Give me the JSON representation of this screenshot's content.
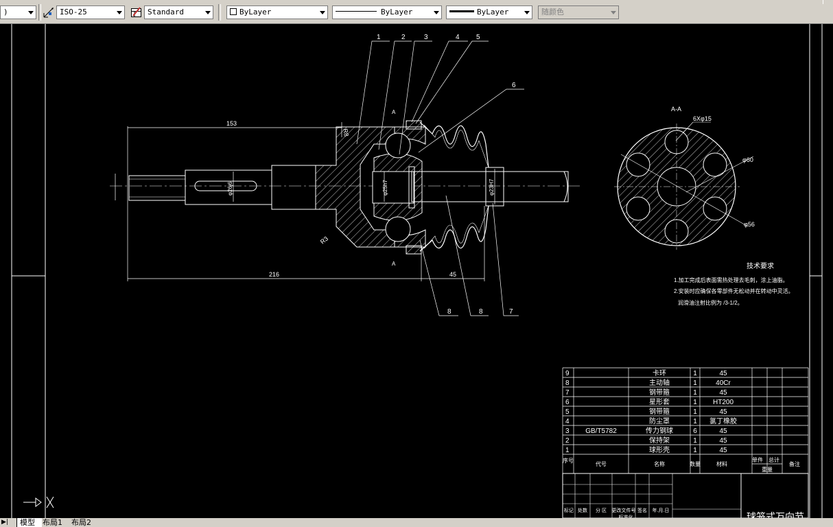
{
  "toolbar": {
    "layer_combo": ")",
    "dimstyle_combo": "ISO-25",
    "tablestyle_combo": "Standard",
    "color_combo": "ByLayer",
    "linetype_combo": "ByLayer",
    "lineweight_combo": "ByLayer",
    "plotstyle_combo": "随颜色"
  },
  "drawing": {
    "dims": {
      "d153": "153",
      "d216": "216",
      "d45": "45",
      "r8": "R8",
      "r3": "R3",
      "phi_shaft": "φ26j6",
      "phi_ball": "φ25h7",
      "phi_seal": "φ23H7",
      "section_mark": "A",
      "section_title": "A-A",
      "holes": "6Xφ15",
      "phi60": "φ60",
      "phi56": "φ56"
    },
    "leaders": [
      "1",
      "2",
      "3",
      "4",
      "5",
      "6",
      "8",
      "8",
      "7"
    ],
    "tech": {
      "title": "技术要求",
      "line1": "1.加工完成后表面需热处理去毛刺，涂上油脂。",
      "line2": "2.安装时应确保各零部件无松动并在转动中灵活。",
      "line3": "润滑油注射比例为 /3-1/2。"
    }
  },
  "bom": {
    "rows": [
      {
        "no": "9",
        "code": "",
        "name": "卡环",
        "qty": "1",
        "mat": "45"
      },
      {
        "no": "8",
        "code": "",
        "name": "主动轴",
        "qty": "1",
        "mat": "40Cr"
      },
      {
        "no": "7",
        "code": "",
        "name": "钢带箍",
        "qty": "1",
        "mat": "45"
      },
      {
        "no": "6",
        "code": "",
        "name": "星形套",
        "qty": "1",
        "mat": "HT200"
      },
      {
        "no": "5",
        "code": "",
        "name": "钢带箍",
        "qty": "1",
        "mat": "45"
      },
      {
        "no": "4",
        "code": "",
        "name": "防尘罩",
        "qty": "1",
        "mat": "氯丁橡胶"
      },
      {
        "no": "3",
        "code": "GB/T5782",
        "name": "传力钢球",
        "qty": "6",
        "mat": "45"
      },
      {
        "no": "2",
        "code": "",
        "name": "保持架",
        "qty": "1",
        "mat": "45"
      },
      {
        "no": "1",
        "code": "",
        "name": "球形壳",
        "qty": "1",
        "mat": "45"
      }
    ],
    "header": {
      "no": "序号",
      "code": "代号",
      "name": "名称",
      "qty": "数量",
      "mat": "材料",
      "unit": "单件",
      "total": "总计",
      "weight": "重量",
      "remark": "备注"
    },
    "title_block": {
      "c1": "标记",
      "c2": "处数",
      "c3": "分 区",
      "c4": "更改文件号",
      "c5": "签名",
      "c6": "年.月.日",
      "c7": "标准化",
      "title": "球笼式万向节"
    }
  },
  "tabs": {
    "model": "模型",
    "layout1": "布局1",
    "layout2": "布局2"
  }
}
